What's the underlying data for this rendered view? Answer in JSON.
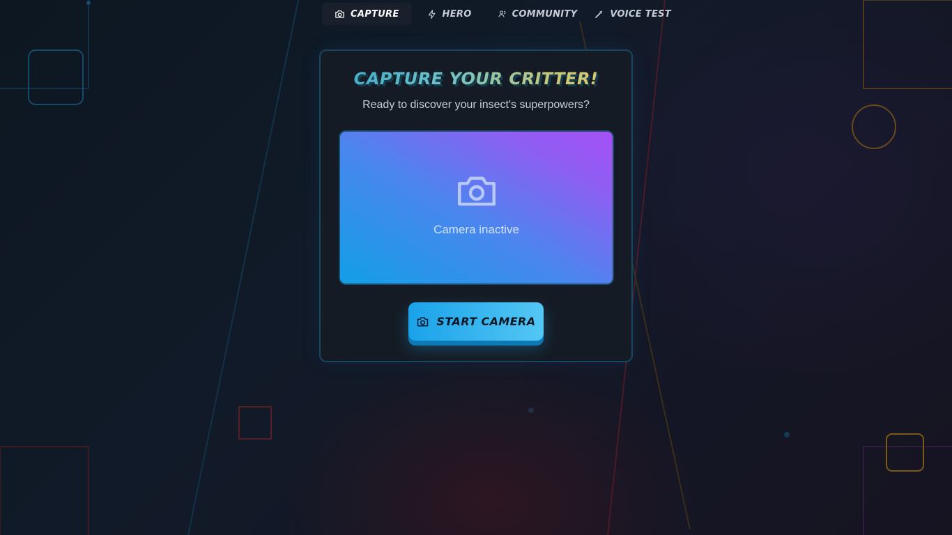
{
  "nav": {
    "tabs": [
      {
        "label": "Capture",
        "icon": "camera-icon",
        "active": true
      },
      {
        "label": "Hero",
        "icon": "lightning-icon",
        "active": false
      },
      {
        "label": "Community",
        "icon": "users-icon",
        "active": false
      },
      {
        "label": "Voice Test",
        "icon": "magic-wand-icon",
        "active": false
      }
    ]
  },
  "card": {
    "title": "Capture Your Critter!",
    "subtitle": "Ready to discover your insect's superpowers?",
    "preview": {
      "icon": "camera-icon",
      "status": "Camera inactive"
    },
    "start_button": {
      "label": "Start Camera",
      "icon": "camera-icon"
    }
  },
  "colors": {
    "accent": "#1aa2ea",
    "card_border": "#174660",
    "preview_gradient_start": "#129fe6",
    "preview_gradient_end": "#a550f5"
  }
}
